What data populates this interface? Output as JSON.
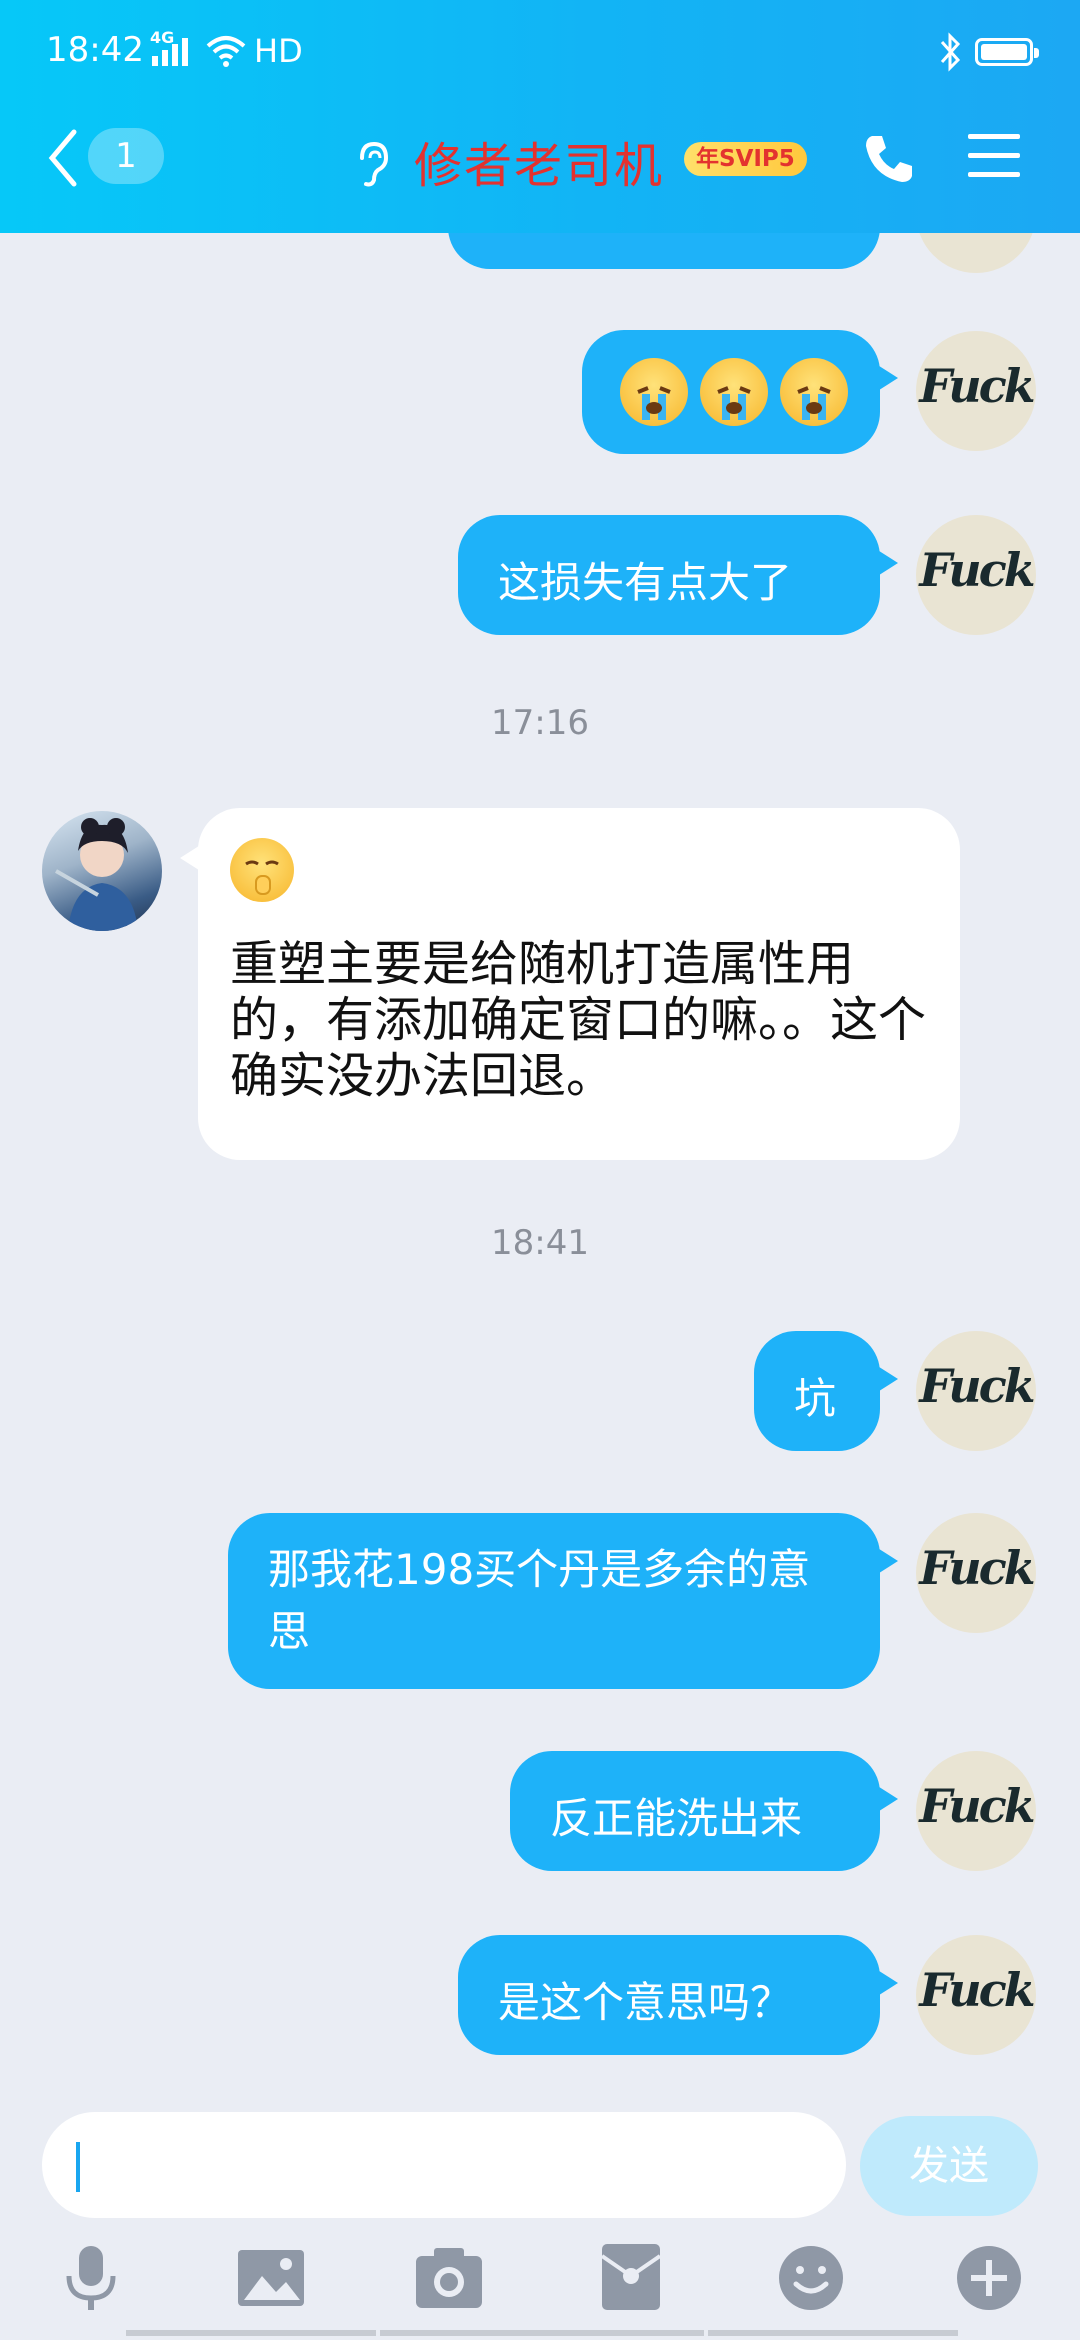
{
  "status_bar": {
    "time": "18:42",
    "network": "4G",
    "extra": "HD"
  },
  "header": {
    "unread_count": "1",
    "contact_name": "修者老司机",
    "badge": "年SVIP5"
  },
  "messages": [
    {
      "type": "emoji",
      "text": "😭😭😭"
    },
    {
      "type": "text",
      "text": "这损失有点大了"
    },
    {
      "type": "time",
      "text": "17:16"
    },
    {
      "type": "in",
      "emoji": "🤫",
      "text": "重塑主要是给随机打造属性用的，有添加确定窗口的嘛。。这个确实没办法回退。"
    },
    {
      "type": "time",
      "text": "18:41"
    },
    {
      "type": "text",
      "text": "坑"
    },
    {
      "type": "text",
      "text": "那我花198买个丹是多余的意思"
    },
    {
      "type": "text",
      "text": "反正能洗出来"
    },
    {
      "type": "text",
      "text": "是这个意思吗？"
    }
  ],
  "avatar_me_text": "Fuck",
  "input": {
    "send_label": "发送"
  },
  "colors": {
    "header": "#12b4f5",
    "bubble_out": "#1eb2f9",
    "title": "#e3322f",
    "background": "#eaedf4"
  },
  "toolbar": [
    "microphone-icon",
    "image-icon",
    "camera-icon",
    "red-packet-icon",
    "emoji-icon",
    "plus-icon"
  ]
}
